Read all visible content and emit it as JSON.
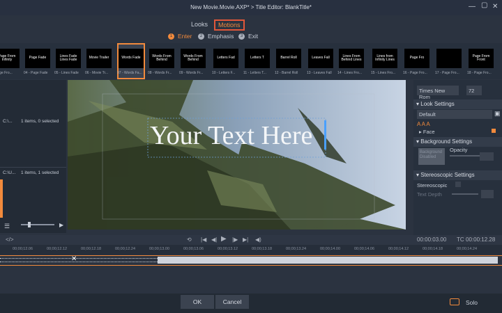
{
  "titlebar": {
    "title": "New Movie.Movie.AXP* > Title Editor: BlankTitle*"
  },
  "modes": {
    "looks": "Looks",
    "motions": "Motions"
  },
  "phases": [
    {
      "num": "1",
      "label": "Enter"
    },
    {
      "num": "2",
      "label": "Emphasis"
    },
    {
      "num": "3",
      "label": "Exit"
    }
  ],
  "thumbs": [
    {
      "img": "Page From Infinity",
      "cap": "- Page Fro..."
    },
    {
      "img": "Page Fade",
      "cap": "04 - Page Fade"
    },
    {
      "img": "Lines Fade Lines Fade",
      "cap": "05 - Lines Fade"
    },
    {
      "img": "Movie Trailer",
      "cap": "06 - Movie Tr..."
    },
    {
      "img": "Words Fade",
      "cap": "07 - Words Fa..."
    },
    {
      "img": "Words From Behind",
      "cap": "08 - Words Fr..."
    },
    {
      "img": "Words From Behind",
      "cap": "09 - Words Fr..."
    },
    {
      "img": "Letters Fad",
      "cap": "10 - Letters F..."
    },
    {
      "img": "Letters T",
      "cap": "11 - Letters T..."
    },
    {
      "img": "Barrel Roll",
      "cap": "12 - Barrel Roll"
    },
    {
      "img": "Leaves Fall",
      "cap": "13 - Leaves Fall"
    },
    {
      "img": "Lines From Behind Lines",
      "cap": "14 - Lines Fro..."
    },
    {
      "img": "Lines from Infinity Lines",
      "cap": "15 - Lines Fro..."
    },
    {
      "img": "Page Fro",
      "cap": "16 - Page Fro..."
    },
    {
      "img": "",
      "cap": "17 - Page Fro..."
    },
    {
      "img": "Page From Front",
      "cap": "18 - Page Fro..."
    }
  ],
  "leftpanel": {
    "row1_a": "C:\\...",
    "row1_b": "1 items, 0 selected",
    "row2_a": "C:\\U...",
    "row2_b": "1 items, 1 selected"
  },
  "preview": {
    "text": "Your Text Here"
  },
  "right": {
    "font": "Times New Rom",
    "size": "72",
    "look_settings": "Look Settings",
    "look_preset": "Default",
    "face": "Face",
    "background_settings": "Background Settings",
    "opacity": "Opacity",
    "bg_label": "Background Disabled",
    "stereoscopic_settings": "Stereoscopic Settings",
    "stereoscopic": "Stereoscopic",
    "text_depth": "Text Depth"
  },
  "timecode": {
    "left": "00:00:03.00",
    "tc": "TC",
    "right": "00:00:12.28"
  },
  "ruler": [
    "00;00;12.06",
    "00;00;12.12",
    "00;00;12.18",
    "00;00;12.24",
    "00;00;13.00",
    "00;00;13.06",
    "00;00;13.12",
    "00;00;13.18",
    "00;00;13.24",
    "00;00;14.00",
    "00;00;14.06",
    "00;00;14.12",
    "00;00;14.18",
    "00;00;14.24"
  ],
  "buttons": {
    "ok": "OK",
    "cancel": "Cancel",
    "solo": "Solo"
  },
  "colors": {
    "accent": "#f28a3c",
    "tab_border": "#e2573a",
    "track": "#cfd4dc"
  }
}
